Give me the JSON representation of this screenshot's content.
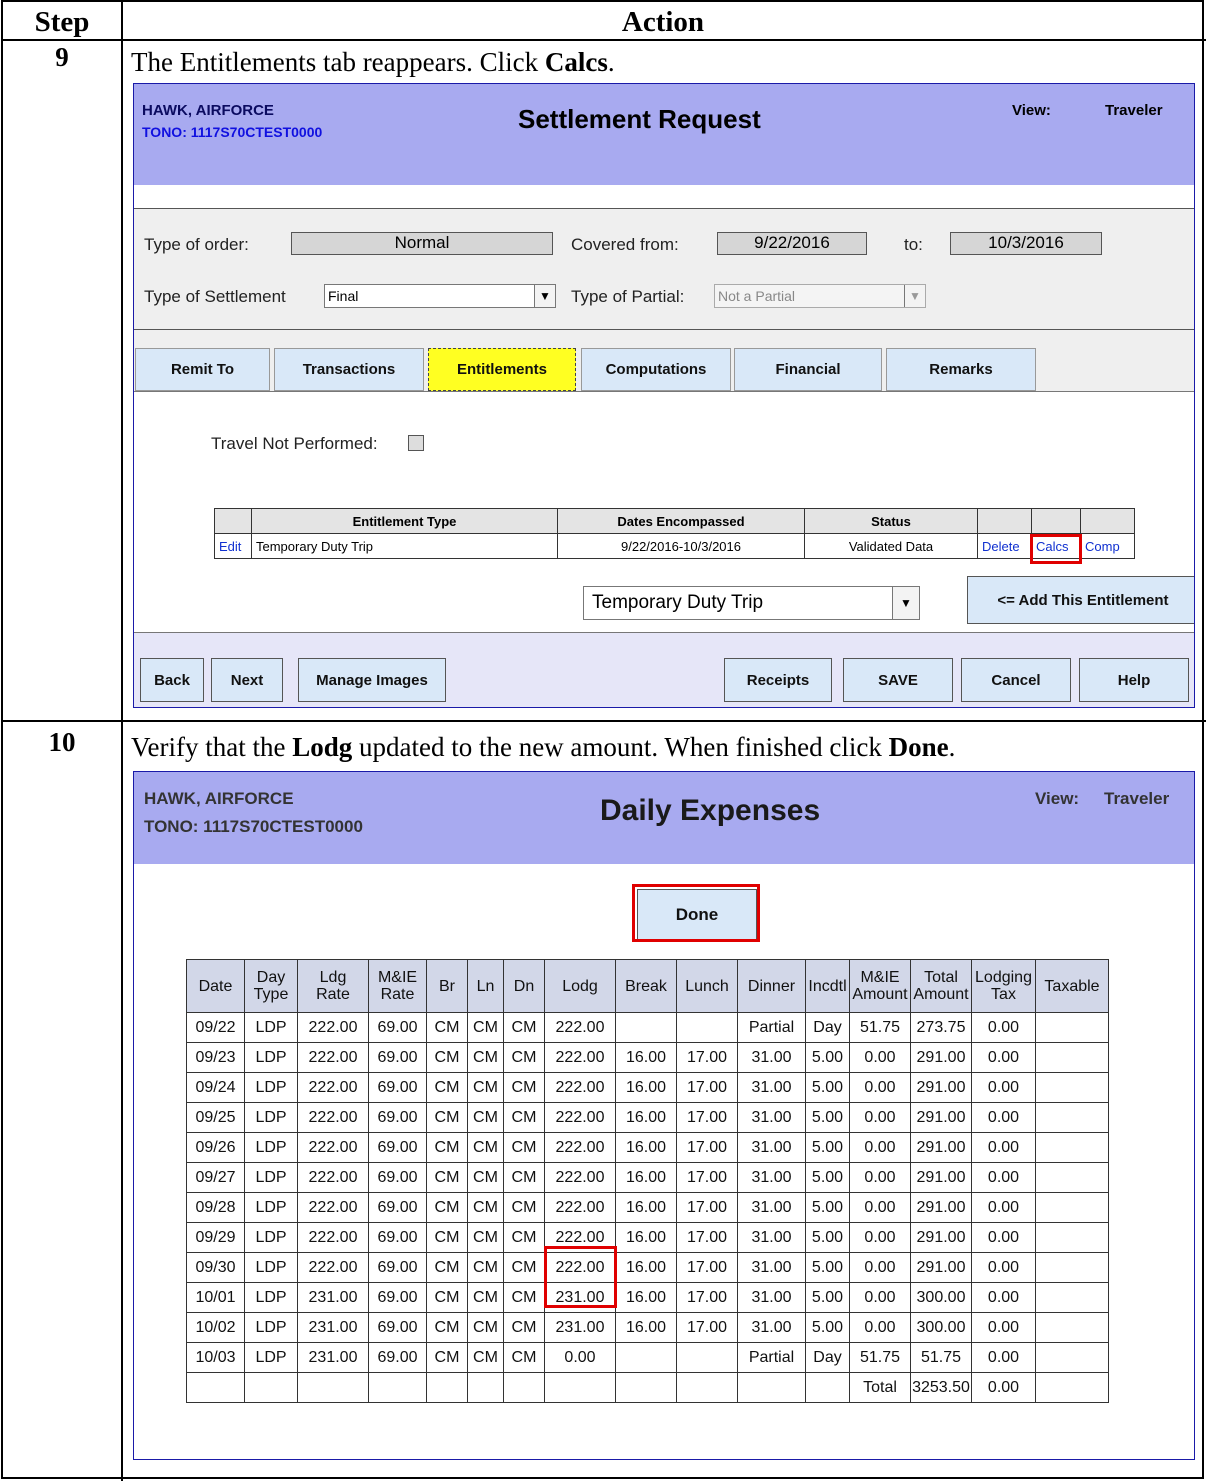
{
  "table_header": {
    "step": "Step",
    "action": "Action"
  },
  "step9": {
    "number": "9",
    "instruction_pre": "The Entitlements tab reappears. Click ",
    "instruction_bold": "Calcs",
    "instruction_post": ".",
    "screen": {
      "name": "HAWK, AIRFORCE",
      "tono": "TONO: 1117S70CTEST0000",
      "title": "Settlement Request",
      "view_label": "View:",
      "view_value": "Traveler",
      "type_of_order_label": "Type of order:",
      "type_of_order_value": "Normal",
      "covered_from_label": "Covered from:",
      "covered_from_value": "9/22/2016",
      "to_label": "to:",
      "to_value": "10/3/2016",
      "type_of_settlement_label": "Type of Settlement",
      "type_of_settlement_value": "Final",
      "type_of_partial_label": "Type of Partial:",
      "type_of_partial_value": "Not a Partial",
      "tabs": [
        "Remit To",
        "Transactions",
        "Entitlements",
        "Computations",
        "Financial",
        "Remarks"
      ],
      "active_tab": "Entitlements",
      "travel_not_performed_label": "Travel Not Performed:",
      "entitlements_table": {
        "headers": [
          "",
          "Entitlement Type",
          "Dates Encompassed",
          "Status",
          "",
          "",
          ""
        ],
        "row": {
          "edit": "Edit",
          "type": "Temporary Duty Trip",
          "dates": "9/22/2016-10/3/2016",
          "status": "Validated Data",
          "delete": "Delete",
          "calcs": "Calcs",
          "comp": "Comp"
        }
      },
      "entitlement_select_value": "Temporary Duty Trip",
      "add_button": "<= Add This Entitlement",
      "bottom_buttons": {
        "back": "Back",
        "next": "Next",
        "manage_images": "Manage Images",
        "receipts": "Receipts",
        "save": "SAVE",
        "cancel": "Cancel",
        "help": "Help"
      }
    }
  },
  "step10": {
    "number": "10",
    "instruction_1": "Verify that the ",
    "instruction_bold1": "Lodg",
    "instruction_2": " updated to the new amount. When finished click ",
    "instruction_bold2": "Done",
    "instruction_3": ".",
    "screen": {
      "name": "HAWK, AIRFORCE",
      "tono": "TONO: 1117S70CTEST0000",
      "title": "Daily Expenses",
      "view_label": "View:",
      "view_value": "Traveler",
      "done_button": "Done",
      "columns": [
        "Date",
        "Day Type",
        "Ldg Rate",
        "M&IE Rate",
        "Br",
        "Ln",
        "Dn",
        "Lodg",
        "Break",
        "Lunch",
        "Dinner",
        "Incdtl",
        "M&IE Amount",
        "Total Amount",
        "Lodging Tax",
        "Taxable"
      ],
      "rows": [
        [
          "09/22",
          "LDP",
          "222.00",
          "69.00",
          "CM",
          "CM",
          "CM",
          "222.00",
          "",
          "",
          "Partial",
          "Day",
          "51.75",
          "273.75",
          "0.00",
          ""
        ],
        [
          "09/23",
          "LDP",
          "222.00",
          "69.00",
          "CM",
          "CM",
          "CM",
          "222.00",
          "16.00",
          "17.00",
          "31.00",
          "5.00",
          "0.00",
          "291.00",
          "0.00",
          ""
        ],
        [
          "09/24",
          "LDP",
          "222.00",
          "69.00",
          "CM",
          "CM",
          "CM",
          "222.00",
          "16.00",
          "17.00",
          "31.00",
          "5.00",
          "0.00",
          "291.00",
          "0.00",
          ""
        ],
        [
          "09/25",
          "LDP",
          "222.00",
          "69.00",
          "CM",
          "CM",
          "CM",
          "222.00",
          "16.00",
          "17.00",
          "31.00",
          "5.00",
          "0.00",
          "291.00",
          "0.00",
          ""
        ],
        [
          "09/26",
          "LDP",
          "222.00",
          "69.00",
          "CM",
          "CM",
          "CM",
          "222.00",
          "16.00",
          "17.00",
          "31.00",
          "5.00",
          "0.00",
          "291.00",
          "0.00",
          ""
        ],
        [
          "09/27",
          "LDP",
          "222.00",
          "69.00",
          "CM",
          "CM",
          "CM",
          "222.00",
          "16.00",
          "17.00",
          "31.00",
          "5.00",
          "0.00",
          "291.00",
          "0.00",
          ""
        ],
        [
          "09/28",
          "LDP",
          "222.00",
          "69.00",
          "CM",
          "CM",
          "CM",
          "222.00",
          "16.00",
          "17.00",
          "31.00",
          "5.00",
          "0.00",
          "291.00",
          "0.00",
          ""
        ],
        [
          "09/29",
          "LDP",
          "222.00",
          "69.00",
          "CM",
          "CM",
          "CM",
          "222.00",
          "16.00",
          "17.00",
          "31.00",
          "5.00",
          "0.00",
          "291.00",
          "0.00",
          ""
        ],
        [
          "09/30",
          "LDP",
          "222.00",
          "69.00",
          "CM",
          "CM",
          "CM",
          "222.00",
          "16.00",
          "17.00",
          "31.00",
          "5.00",
          "0.00",
          "291.00",
          "0.00",
          ""
        ],
        [
          "10/01",
          "LDP",
          "231.00",
          "69.00",
          "CM",
          "CM",
          "CM",
          "231.00",
          "16.00",
          "17.00",
          "31.00",
          "5.00",
          "0.00",
          "300.00",
          "0.00",
          ""
        ],
        [
          "10/02",
          "LDP",
          "231.00",
          "69.00",
          "CM",
          "CM",
          "CM",
          "231.00",
          "16.00",
          "17.00",
          "31.00",
          "5.00",
          "0.00",
          "300.00",
          "0.00",
          ""
        ],
        [
          "10/03",
          "LDP",
          "231.00",
          "69.00",
          "CM",
          "CM",
          "CM",
          "0.00",
          "",
          "",
          "Partial",
          "Day",
          "51.75",
          "51.75",
          "0.00",
          ""
        ],
        [
          "",
          "",
          "",
          "",
          "",
          "",
          "",
          "",
          "",
          "",
          "",
          "",
          "Total",
          "3253.50",
          "0.00",
          ""
        ]
      ]
    }
  },
  "colors": {
    "titlebar": "#a8aaf0",
    "tab": "#d9e8f8",
    "active_tab": "#ffff22",
    "highlight": "#e00000",
    "link": "#1030d0"
  }
}
